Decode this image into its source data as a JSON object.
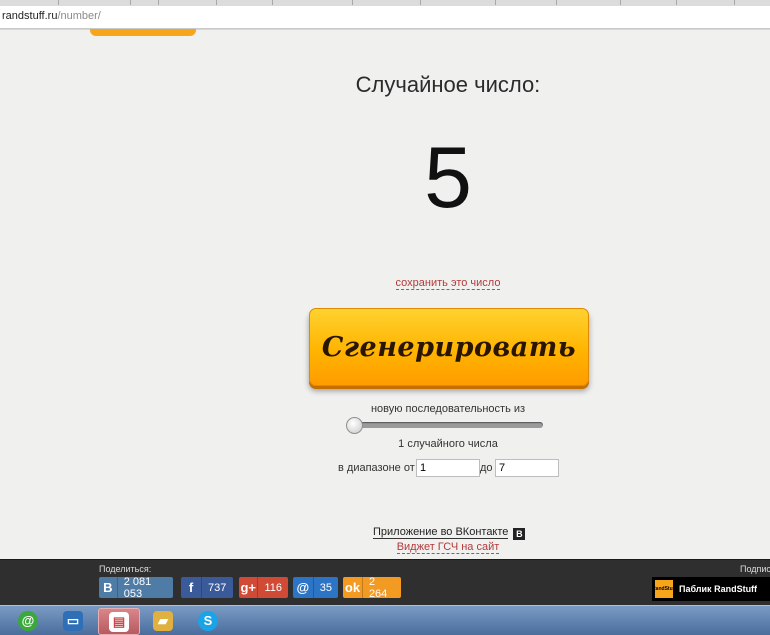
{
  "browser": {
    "url_domain": "randstuff.ru",
    "url_path": "/number/"
  },
  "main": {
    "heading": "Случайное число:",
    "result": "5",
    "save_link": "сохранить это число",
    "generate_button": "Сгенерировать",
    "sequence_label": "новую последовательность из",
    "slider_value": 1,
    "count_label": "1 случайного числа",
    "range_from_label": "в диапазоне от",
    "range_from_value": "1",
    "range_to_label": "до",
    "range_to_value": "7",
    "vk_app_link": "Приложение во ВКонтакте",
    "vk_icon_letter": "B",
    "widget_link": "Виджет ГСЧ на сайт"
  },
  "sharebar": {
    "share_title": "Поделиться:",
    "subscribe_title": "Подпис",
    "buttons": [
      {
        "network": "vk",
        "icon": "B",
        "count": "2 081 053"
      },
      {
        "network": "facebook",
        "icon": "f",
        "count": "737"
      },
      {
        "network": "google-plus",
        "icon": "g+",
        "count": "116"
      },
      {
        "network": "mail-ru",
        "icon": "@",
        "count": "35"
      },
      {
        "network": "odnoklassniki",
        "icon": "ok",
        "count": "2 264"
      }
    ],
    "public_label": "Паблик RandStuff",
    "public_logo_text": "RandStuff"
  },
  "taskbar": {
    "apps": [
      {
        "name": "mail-agent",
        "glyph": "@",
        "color": "#3aa83a"
      },
      {
        "name": "computer",
        "glyph": "▭",
        "color": "#2e6fb8"
      },
      {
        "name": "document",
        "glyph": "▤",
        "color": "#c84a4a"
      },
      {
        "name": "folder",
        "glyph": "▰",
        "color": "#e0b040"
      },
      {
        "name": "skype",
        "glyph": "S",
        "color": "#1aa3e6"
      }
    ]
  },
  "colors": {
    "accent": "#f7a51b",
    "link_red": "#b33a3a",
    "page_bg": "#f0f0ef"
  }
}
